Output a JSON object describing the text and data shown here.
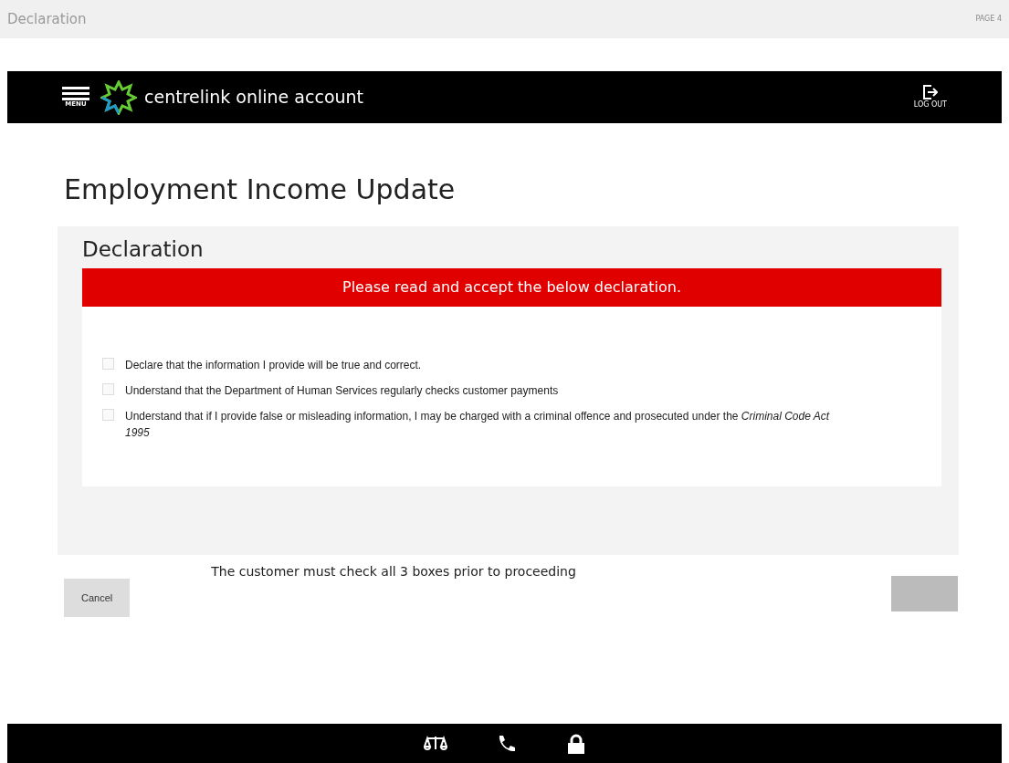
{
  "page_header": {
    "title": "Declaration",
    "page_label": "PAGE 4"
  },
  "navbar": {
    "menu_label": "MENU",
    "brand": "centrelink online account",
    "logout_label": "LOG OUT"
  },
  "heading": "Employment Income Update",
  "section": {
    "title": "Declaration",
    "alert": "Please read and accept the below declaration.",
    "items": [
      {
        "text": "Declare that the information I provide will be true and correct.",
        "checked": false
      },
      {
        "text": "Understand that the Department of Human Services regularly checks customer payments",
        "checked": false
      },
      {
        "text": "Understand that if I provide false or misleading information, I may be charged with a criminal offence and prosecuted under the *Criminal Code Act 1995*",
        "checked": false
      }
    ]
  },
  "note": "The customer must check all 3 boxes prior to proceeding",
  "buttons": [
    {
      "kind": "cancel",
      "label": "Cancel"
    },
    {
      "kind": "next",
      "disabled": true
    }
  ]
}
